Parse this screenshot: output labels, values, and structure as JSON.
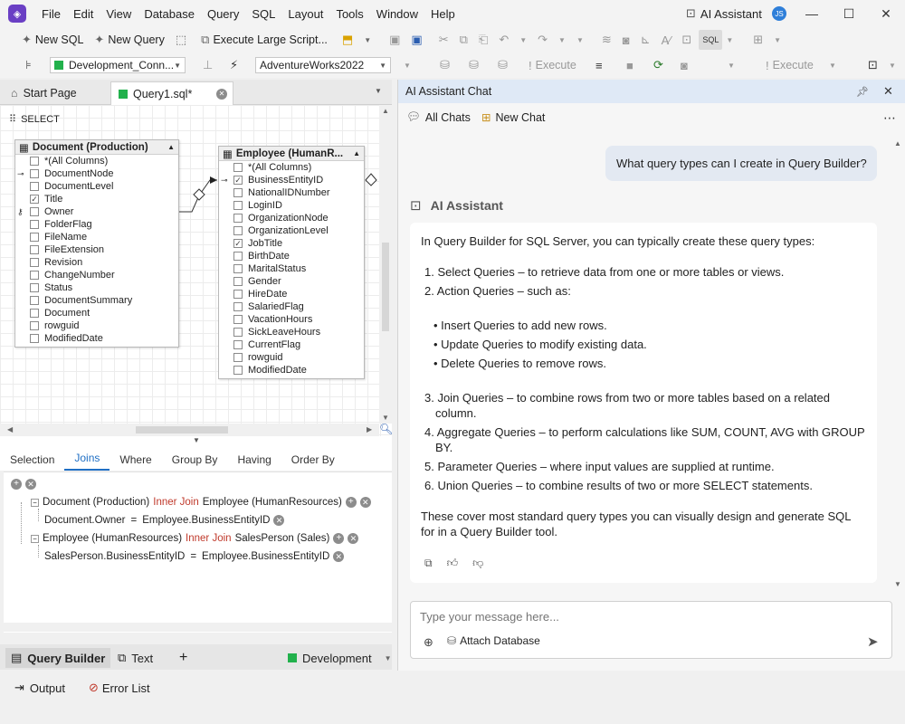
{
  "menu": {
    "items": [
      "File",
      "Edit",
      "View",
      "Database",
      "Query",
      "SQL",
      "Layout",
      "Tools",
      "Window",
      "Help"
    ],
    "ai_assistant": "AI Assistant",
    "avatar_initials": "JS"
  },
  "toolbar1": {
    "new_sql": "New SQL",
    "new_query": "New Query",
    "execute_large_script": "Execute Large Script...",
    "sql_label": "SQL"
  },
  "toolbar2": {
    "connection": "Development_Conn...",
    "database": "AdventureWorks2022",
    "execute_1": "Execute",
    "execute_2": "Execute"
  },
  "doc_tabs": {
    "start_page": "Start Page",
    "query_tab": "Query1.sql*"
  },
  "diagram": {
    "select_label": "SELECT",
    "table1": {
      "title": "Document (Production)",
      "columns": [
        {
          "name": "*(All Columns)",
          "checked": false,
          "key": ""
        },
        {
          "name": "DocumentNode",
          "checked": false,
          "key": "pk"
        },
        {
          "name": "DocumentLevel",
          "checked": false,
          "key": ""
        },
        {
          "name": "Title",
          "checked": true,
          "key": ""
        },
        {
          "name": "Owner",
          "checked": false,
          "key": "fk"
        },
        {
          "name": "FolderFlag",
          "checked": false,
          "key": ""
        },
        {
          "name": "FileName",
          "checked": false,
          "key": ""
        },
        {
          "name": "FileExtension",
          "checked": false,
          "key": ""
        },
        {
          "name": "Revision",
          "checked": false,
          "key": ""
        },
        {
          "name": "ChangeNumber",
          "checked": false,
          "key": ""
        },
        {
          "name": "Status",
          "checked": false,
          "key": ""
        },
        {
          "name": "DocumentSummary",
          "checked": false,
          "key": ""
        },
        {
          "name": "Document",
          "checked": false,
          "key": ""
        },
        {
          "name": "rowguid",
          "checked": false,
          "key": ""
        },
        {
          "name": "ModifiedDate",
          "checked": false,
          "key": ""
        }
      ]
    },
    "table2": {
      "title": "Employee (HumanR...",
      "columns": [
        {
          "name": "*(All Columns)",
          "checked": false,
          "key": ""
        },
        {
          "name": "BusinessEntityID",
          "checked": true,
          "key": "pk"
        },
        {
          "name": "NationalIDNumber",
          "checked": false,
          "key": ""
        },
        {
          "name": "LoginID",
          "checked": false,
          "key": ""
        },
        {
          "name": "OrganizationNode",
          "checked": false,
          "key": ""
        },
        {
          "name": "OrganizationLevel",
          "checked": false,
          "key": ""
        },
        {
          "name": "JobTitle",
          "checked": true,
          "key": ""
        },
        {
          "name": "BirthDate",
          "checked": false,
          "key": ""
        },
        {
          "name": "MaritalStatus",
          "checked": false,
          "key": ""
        },
        {
          "name": "Gender",
          "checked": false,
          "key": ""
        },
        {
          "name": "HireDate",
          "checked": false,
          "key": ""
        },
        {
          "name": "SalariedFlag",
          "checked": false,
          "key": ""
        },
        {
          "name": "VacationHours",
          "checked": false,
          "key": ""
        },
        {
          "name": "SickLeaveHours",
          "checked": false,
          "key": ""
        },
        {
          "name": "CurrentFlag",
          "checked": false,
          "key": ""
        },
        {
          "name": "rowguid",
          "checked": false,
          "key": ""
        },
        {
          "name": "ModifiedDate",
          "checked": false,
          "key": ""
        }
      ]
    }
  },
  "query_tabs": [
    "Selection",
    "Joins",
    "Where",
    "Group By",
    "Having",
    "Order By"
  ],
  "joins": {
    "join1": {
      "left": "Document (Production)",
      "type": "Inner Join",
      "right": "Employee (HumanResources)",
      "condition_left": "Document.Owner",
      "op": "=",
      "condition_right": "Employee.BusinessEntityID"
    },
    "join2": {
      "left": "Employee (HumanResources)",
      "type": "Inner Join",
      "right": "SalesPerson (Sales)",
      "condition_left": "SalesPerson.BusinessEntityID",
      "op": "=",
      "condition_right": "Employee.BusinessEntityID"
    }
  },
  "bottom_tabs": {
    "query_builder": "Query Builder",
    "text": "Text",
    "add": "+",
    "connection": "Development"
  },
  "status": {
    "output": "Output",
    "error_list": "Error List"
  },
  "ai": {
    "panel_title": "AI Assistant Chat",
    "all_chats": "All Chats",
    "new_chat": "New Chat",
    "user_message": "What query types can I create in Query Builder?",
    "assistant_name": "AI Assistant",
    "intro": "In Query Builder for SQL Server, you can typically create these query types:",
    "item1": "1. Select Queries – to retrieve data from one or more tables or views.",
    "item2": "2. Action Queries – such as:",
    "sub1": "• Insert Queries to add new rows.",
    "sub2": "• Update Queries to modify existing data.",
    "sub3": "• Delete Queries to remove rows.",
    "item3": "3. Join Queries – to combine rows from two or more tables based on a related column.",
    "item4": "4. Aggregate Queries – to perform calculations like SUM, COUNT, AVG with GROUP BY.",
    "item5": "5. Parameter Queries – where input values are supplied at runtime.",
    "item6": "6. Union Queries – to combine results of two or more SELECT statements.",
    "outro": "These cover most standard query types you can visually design and generate SQL for in a Query Builder tool.",
    "input_placeholder": "Type your message here...",
    "attach_database": "Attach Database"
  }
}
